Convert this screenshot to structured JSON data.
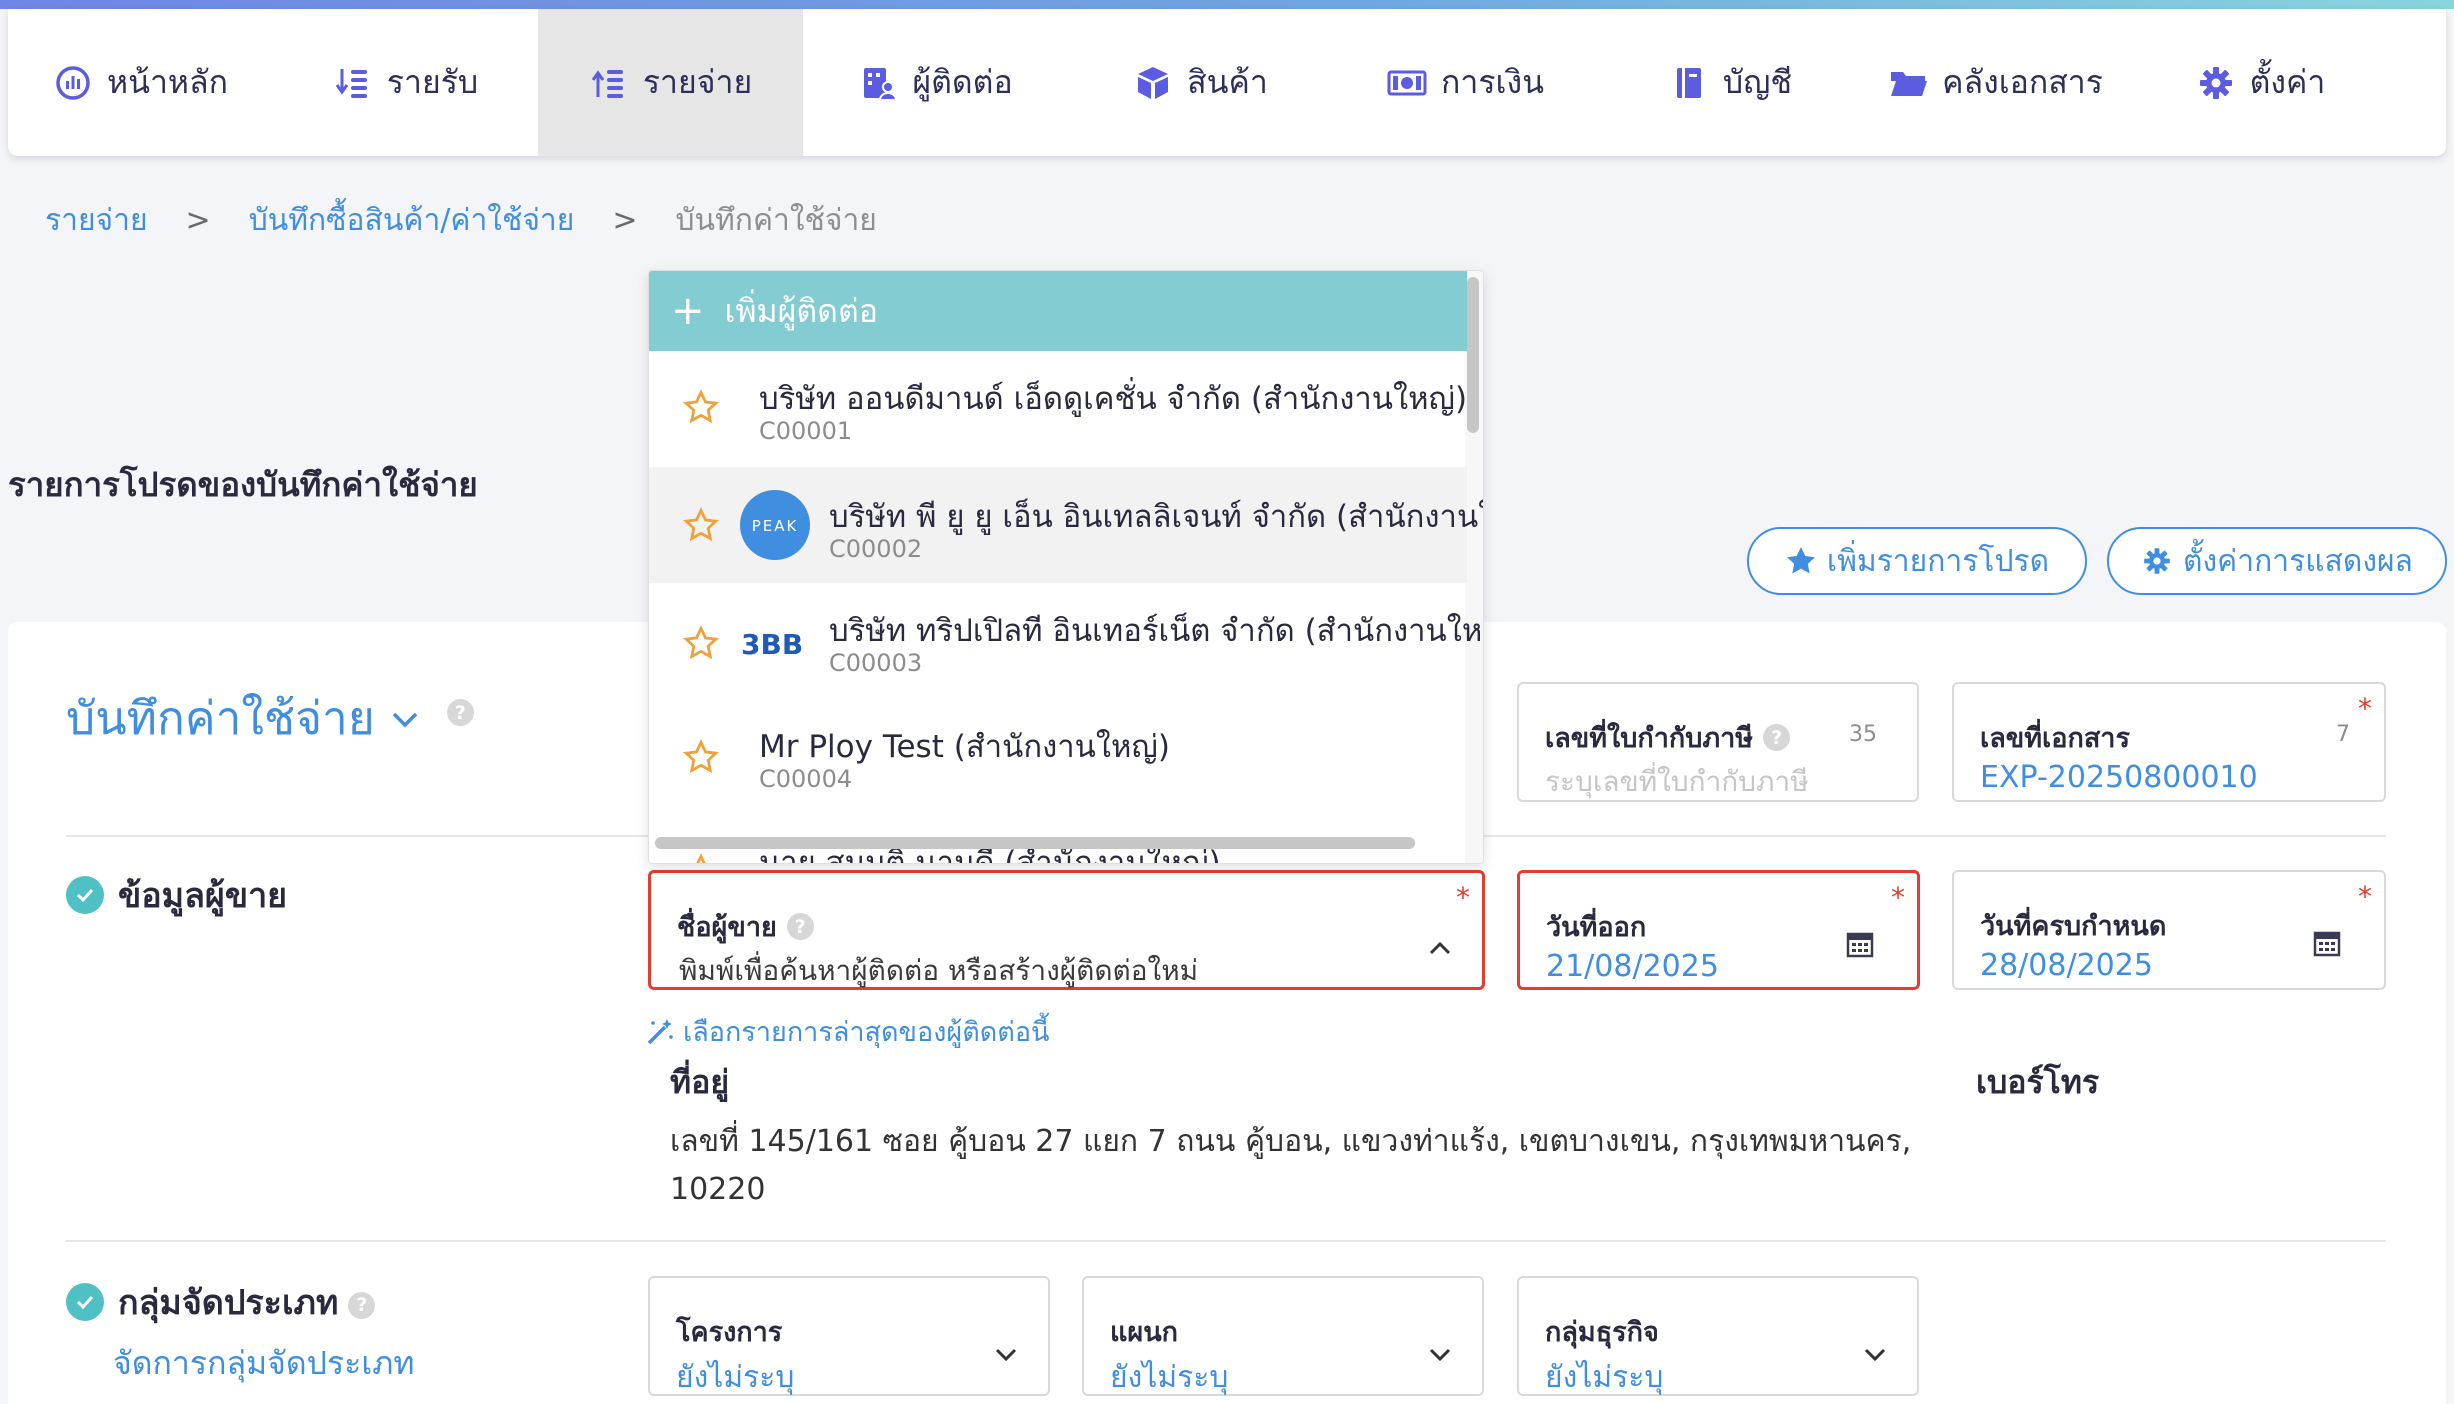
{
  "nav": {
    "items": [
      {
        "label": "หน้าหลัก",
        "icon": "dashboard-icon"
      },
      {
        "label": "รายรับ",
        "icon": "income-icon"
      },
      {
        "label": "รายจ่าย",
        "icon": "expense-icon",
        "active": true
      },
      {
        "label": "ผู้ติดต่อ",
        "icon": "contact-icon"
      },
      {
        "label": "สินค้า",
        "icon": "product-box-icon"
      },
      {
        "label": "การเงิน",
        "icon": "money-icon"
      },
      {
        "label": "บัญชี",
        "icon": "accounting-book-icon"
      },
      {
        "label": "คลังเอกสาร",
        "icon": "folder-icon"
      },
      {
        "label": "ตั้งค่า",
        "icon": "gear-icon"
      }
    ]
  },
  "breadcrumb": {
    "items": [
      "รายจ่าย",
      "บันทึกซื้อสินค้า/ค่าใช้จ่าย"
    ],
    "separator": ">",
    "current": "บันทึกค่าใช้จ่าย"
  },
  "favorites": {
    "title": "รายการโปรดของบันทึกค่าใช้จ่าย",
    "add_button": "เพิ่มรายการโปรด",
    "display_button": "ตั้งค่าการแสดงผล"
  },
  "document": {
    "title": "บันทึกค่าใช้จ่าย",
    "tax_invoice_no": {
      "label": "เลขที่ใบกำกับภาษี",
      "placeholder": "ระบุเลขที่ใบกำกับภาษี",
      "counter": "35"
    },
    "doc_no": {
      "label": "เลขที่เอกสาร",
      "value": "EXP-20250800010",
      "counter": "7",
      "required": "*"
    }
  },
  "seller": {
    "section_title": "ข้อมูลผู้ขาย",
    "name_field": {
      "label": "ชื่อผู้ขาย",
      "placeholder": "พิมพ์เพื่อค้นหาผู้ติดต่อ หรือสร้างผู้ติดต่อใหม่",
      "required": "*"
    },
    "issue_date": {
      "label": "วันที่ออก",
      "value": "21/08/2025",
      "required": "*"
    },
    "due_date": {
      "label": "วันที่ครบกำหนด",
      "value": "28/08/2025",
      "required": "*"
    },
    "recent_hint": "เลือกรายการล่าสุดของผู้ติดต่อนี้",
    "address_label": "ที่อยู่",
    "phone_label": "เบอร์โทร",
    "address": "เลขที่ 145/161 ซอย คู้บอน 27 แยก 7 ถนน คู้บอน, แขวงท่าแร้ง, เขตบางเขน, กรุงเทพมหานคร, 10220"
  },
  "classification": {
    "section_title": "กลุ่มจัดประเภท",
    "manage_link": "จัดการกลุ่มจัดประเภท",
    "fields": [
      {
        "label": "โครงการ",
        "value": "ยังไม่ระบุ"
      },
      {
        "label": "แผนก",
        "value": "ยังไม่ระบุ"
      },
      {
        "label": "กลุ่มธุรกิจ",
        "value": "ยังไม่ระบุ"
      }
    ]
  },
  "dropdown": {
    "add_label": "เพิ่มผู้ติดต่อ",
    "contacts": [
      {
        "name": "บริษัท ออนดีมานด์ เอ็ดดูเคชั่น จำกัด (สำนักงานใหญ่)",
        "code": "C00001",
        "logo": ""
      },
      {
        "name": "บริษัท พี ยู ยู เอ็น อินเทลลิเจนท์ จำกัด (สำนักงานใหญ่)",
        "code": "C00002",
        "logo": "PEAK"
      },
      {
        "name": "บริษัท ทริปเปิลที อินเทอร์เน็ต จำกัด (สำนักงานใหญ่)",
        "code": "C00003",
        "logo": "3BB"
      },
      {
        "name": "Mr Ploy Test (สำนักงานใหญ่)",
        "code": "C00004",
        "logo": ""
      },
      {
        "name": "นาย สมมติ นามดี (สำนักงานใหญ่)",
        "code": "",
        "logo": ""
      }
    ]
  },
  "colors": {
    "accent": "#3f8ee0",
    "teal": "#82ccd2",
    "required": "#e23d2e",
    "nav_active_bg": "#e6e6e6"
  }
}
